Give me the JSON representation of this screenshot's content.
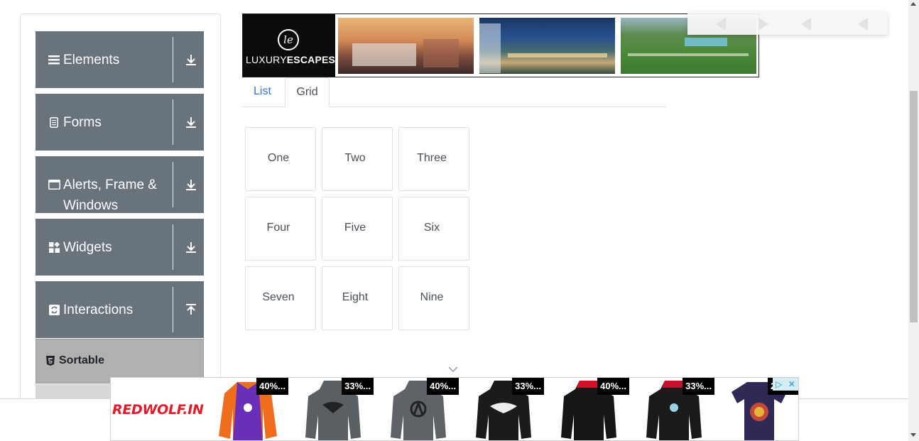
{
  "sidebar": {
    "groups": [
      {
        "label": "Elements",
        "icon": "bars-icon",
        "state": "collapsed"
      },
      {
        "label": "Forms",
        "icon": "document-icon",
        "state": "collapsed"
      },
      {
        "label": "Alerts, Frame & Windows",
        "icon": "window-icon",
        "state": "collapsed"
      },
      {
        "label": "Widgets",
        "icon": "widgets-icon",
        "state": "collapsed"
      },
      {
        "label": "Interactions",
        "icon": "refresh-icon",
        "state": "expanded"
      }
    ],
    "active_item": {
      "label": "Sortable",
      "icon": "html5-icon"
    }
  },
  "ad_top": {
    "brand_mark": "le",
    "brand_light": "LUXURY",
    "brand_bold": "ESCAPES"
  },
  "tabs": [
    {
      "label": "List",
      "active": false
    },
    {
      "label": "Grid",
      "active": true
    }
  ],
  "grid_items": [
    "One",
    "Two",
    "Three",
    "Four",
    "Five",
    "Six",
    "Seven",
    "Eight",
    "Nine"
  ],
  "ad_bottom": {
    "logo": "REDWOLF.IN",
    "products": [
      {
        "badge": "40%...",
        "item": "jacket-icon",
        "color": "#ef6d1c"
      },
      {
        "badge": "33%...",
        "item": "hoodie-icon",
        "color": "#5a5f63"
      },
      {
        "badge": "40%...",
        "item": "hoodie-icon",
        "color": "#5f6367"
      },
      {
        "badge": "33%...",
        "item": "hoodie-icon",
        "color": "#1b1b1b"
      },
      {
        "badge": "40%...",
        "item": "hoodie-icon",
        "color": "#161616"
      },
      {
        "badge": "33%...",
        "item": "hoodie-icon",
        "color": "#1a1a1a"
      },
      {
        "badge": "25%...",
        "item": "tshirt-icon",
        "color": "#2e2a55"
      }
    ]
  },
  "colors": {
    "sidebar_group": "#69737c",
    "active_item": "#b0b0b0",
    "tab_link": "#2f74e7",
    "brand_red": "#e21b2a"
  }
}
